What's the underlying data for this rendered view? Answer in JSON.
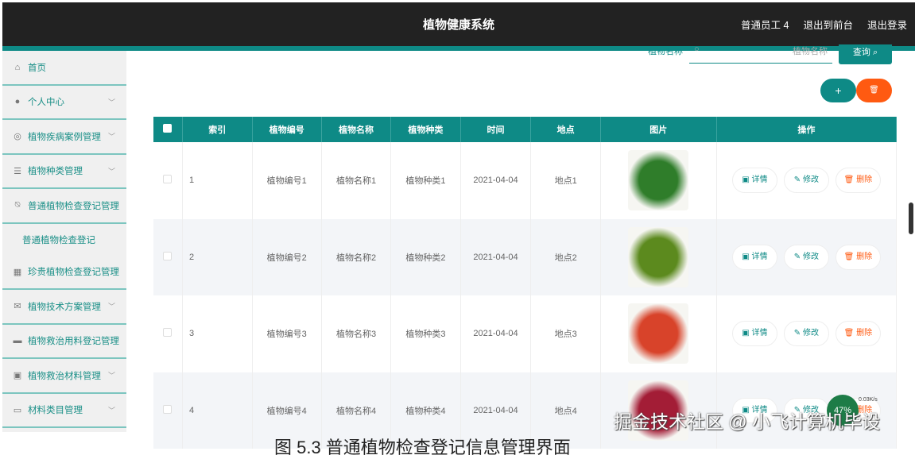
{
  "header": {
    "title": "植物健康系统",
    "user": "普通员工 4",
    "to_front": "退出到前台",
    "logout": "退出登录"
  },
  "sidebar": {
    "items": [
      {
        "label": "首页",
        "icon": "home-icon",
        "glyph": "⌂",
        "chev": false
      },
      {
        "label": "个人中心",
        "icon": "user-icon",
        "glyph": "●",
        "chev": true
      },
      {
        "label": "植物疾病案例管理",
        "icon": "circle-icon",
        "glyph": "◎",
        "chev": true
      },
      {
        "label": "植物种类管理",
        "icon": "list-icon",
        "glyph": "☰",
        "chev": true
      },
      {
        "label": "普通植物检查登记管理",
        "icon": "bell-off-icon",
        "glyph": "⍉",
        "chev": false
      },
      {
        "label": "普通植物检查登记",
        "icon": "",
        "glyph": "",
        "sub": true
      },
      {
        "label": "珍贵植物检查登记管理",
        "icon": "grid-icon",
        "glyph": "▦",
        "chev": false
      },
      {
        "label": "植物技术方案管理",
        "icon": "mail-icon",
        "glyph": "✉",
        "chev": true
      },
      {
        "label": "植物救治用料登记管理",
        "icon": "monitor-icon",
        "glyph": "▬",
        "chev": false
      },
      {
        "label": "植物救治材料管理",
        "icon": "chart-icon",
        "glyph": "▣",
        "chev": true
      },
      {
        "label": "材料类目管理",
        "icon": "card-icon",
        "glyph": "▭",
        "chev": true
      }
    ]
  },
  "search": {
    "label": "植物名称",
    "placeholder": "植物名称",
    "query": "查询 ⌕",
    "add": "+",
    "delete": "🗑"
  },
  "table": {
    "headers": [
      "索引",
      "植物编号",
      "植物名称",
      "植物种类",
      "时间",
      "地点",
      "图片",
      "操作"
    ],
    "rows": [
      {
        "index": "1",
        "code": "植物编号1",
        "name": "植物名称1",
        "kind": "植物种类1",
        "date": "2021-04-04",
        "place": "地点1",
        "color": "#2f7d2a"
      },
      {
        "index": "2",
        "code": "植物编号2",
        "name": "植物名称2",
        "kind": "植物种类2",
        "date": "2021-04-04",
        "place": "地点2",
        "color": "#5c8a1e"
      },
      {
        "index": "3",
        "code": "植物编号3",
        "name": "植物名称3",
        "kind": "植物种类3",
        "date": "2021-04-04",
        "place": "地点3",
        "color": "#d8432a"
      },
      {
        "index": "4",
        "code": "植物编号4",
        "name": "植物名称4",
        "kind": "植物种类4",
        "date": "2021-04-04",
        "place": "地点4",
        "color": "#a31d36"
      }
    ],
    "ops": {
      "detail": "▣ 详情",
      "edit": "✎ 修改",
      "delete": "🗑 删除"
    }
  },
  "overlay": {
    "watermark": "掘金技术社区 @ 小飞计算机毕设",
    "caption": "图 5.3  普通植物检查登记信息管理界面",
    "speed": "47%",
    "net": "0.03K/s"
  }
}
